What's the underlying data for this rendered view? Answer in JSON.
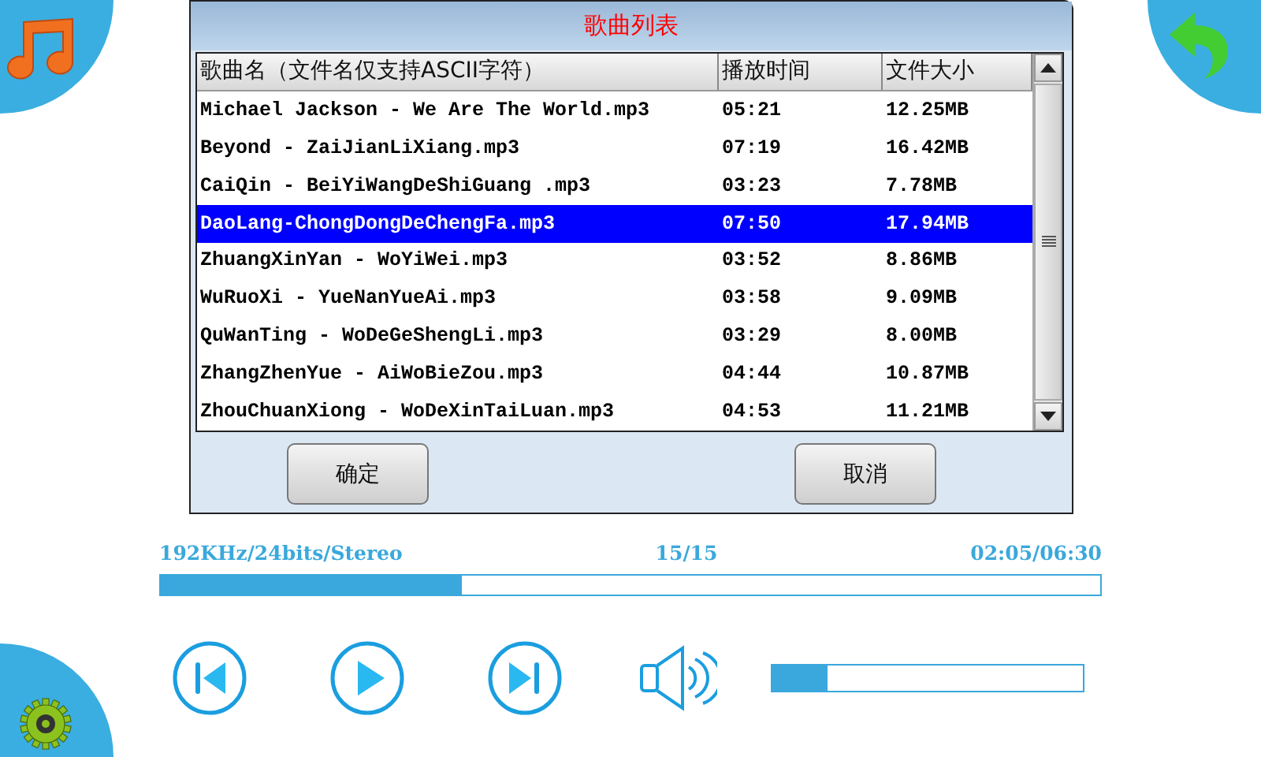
{
  "dialog": {
    "title": "歌曲列表",
    "table": {
      "columns": [
        "歌曲名（文件名仅支持ASCII字符）",
        "播放时间",
        "文件大小"
      ],
      "rows": [
        {
          "name": "Michael Jackson - We Are The World.mp3",
          "time": "05:21",
          "size": "12.25MB",
          "selected": false
        },
        {
          "name": "Beyond - ZaiJianLiXiang.mp3",
          "time": "07:19",
          "size": "16.42MB",
          "selected": false
        },
        {
          "name": "CaiQin - BeiYiWangDeShiGuang .mp3",
          "time": "03:23",
          "size": "7.78MB",
          "selected": false
        },
        {
          "name": "DaoLang-ChongDongDeChengFa.mp3",
          "time": "07:50",
          "size": "17.94MB",
          "selected": true
        },
        {
          "name": "ZhuangXinYan - WoYiWei.mp3",
          "time": "03:52",
          "size": "8.86MB",
          "selected": false
        },
        {
          "name": "WuRuoXi - YueNanYueAi.mp3",
          "time": "03:58",
          "size": "9.09MB",
          "selected": false
        },
        {
          "name": "QuWanTing - WoDeGeShengLi.mp3",
          "time": "03:29",
          "size": "8.00MB",
          "selected": false
        },
        {
          "name": "ZhangZhenYue - AiWoBieZou.mp3",
          "time": "04:44",
          "size": "10.87MB",
          "selected": false
        },
        {
          "name": "ZhouChuanXiong - WoDeXinTaiLuan.mp3",
          "time": "04:53",
          "size": "11.21MB",
          "selected": false
        }
      ]
    },
    "buttons": [
      "确定",
      "取消"
    ]
  },
  "player": {
    "format": "192KHz/24bits/Stereo",
    "track": "15/15",
    "time": "02:05/06:30",
    "progress": {
      "level": 0.32
    },
    "volume": {
      "level": 0.18
    }
  }
}
